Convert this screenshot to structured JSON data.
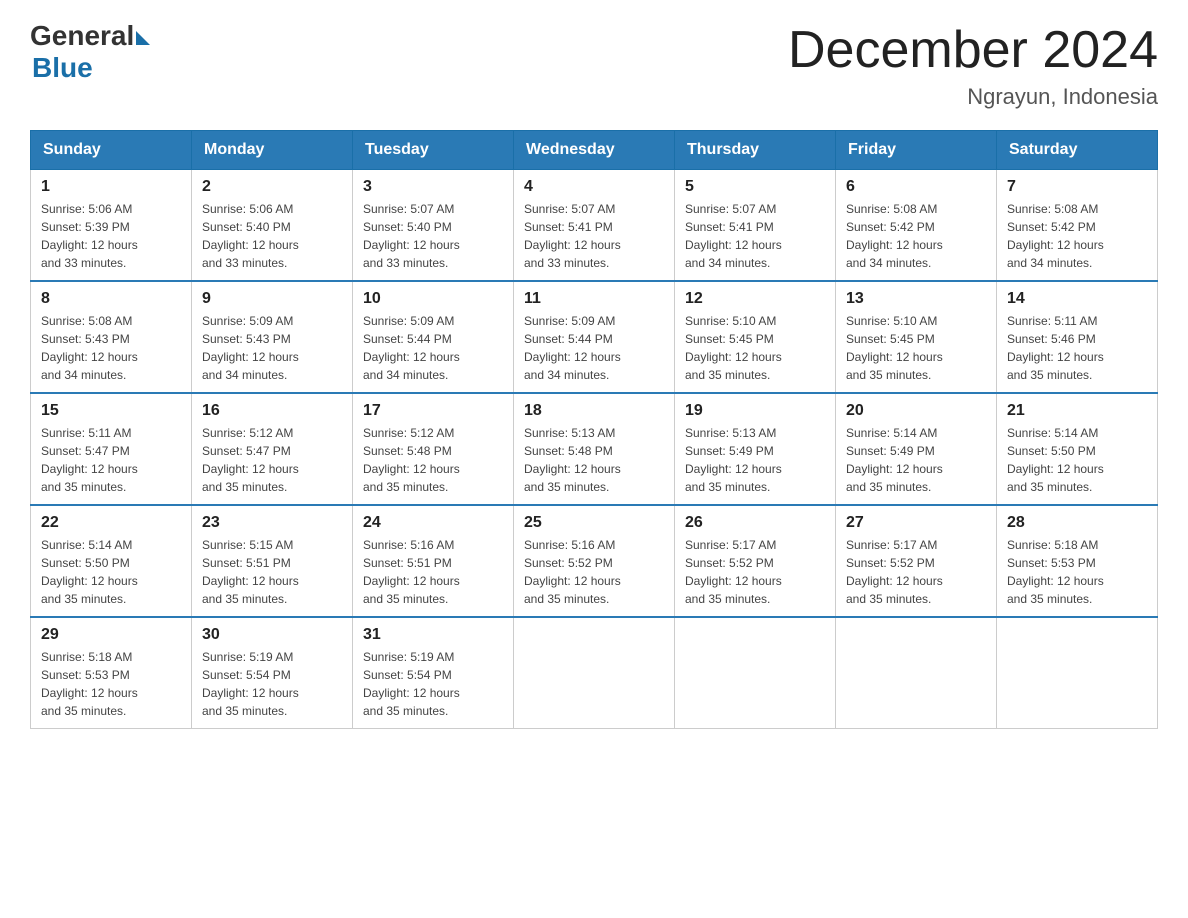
{
  "header": {
    "logo_general": "General",
    "logo_blue": "Blue",
    "month_title": "December 2024",
    "location": "Ngrayun, Indonesia"
  },
  "days_of_week": [
    "Sunday",
    "Monday",
    "Tuesday",
    "Wednesday",
    "Thursday",
    "Friday",
    "Saturday"
  ],
  "weeks": [
    [
      {
        "day": "1",
        "sunrise": "5:06 AM",
        "sunset": "5:39 PM",
        "daylight": "12 hours and 33 minutes."
      },
      {
        "day": "2",
        "sunrise": "5:06 AM",
        "sunset": "5:40 PM",
        "daylight": "12 hours and 33 minutes."
      },
      {
        "day": "3",
        "sunrise": "5:07 AM",
        "sunset": "5:40 PM",
        "daylight": "12 hours and 33 minutes."
      },
      {
        "day": "4",
        "sunrise": "5:07 AM",
        "sunset": "5:41 PM",
        "daylight": "12 hours and 33 minutes."
      },
      {
        "day": "5",
        "sunrise": "5:07 AM",
        "sunset": "5:41 PM",
        "daylight": "12 hours and 34 minutes."
      },
      {
        "day": "6",
        "sunrise": "5:08 AM",
        "sunset": "5:42 PM",
        "daylight": "12 hours and 34 minutes."
      },
      {
        "day": "7",
        "sunrise": "5:08 AM",
        "sunset": "5:42 PM",
        "daylight": "12 hours and 34 minutes."
      }
    ],
    [
      {
        "day": "8",
        "sunrise": "5:08 AM",
        "sunset": "5:43 PM",
        "daylight": "12 hours and 34 minutes."
      },
      {
        "day": "9",
        "sunrise": "5:09 AM",
        "sunset": "5:43 PM",
        "daylight": "12 hours and 34 minutes."
      },
      {
        "day": "10",
        "sunrise": "5:09 AM",
        "sunset": "5:44 PM",
        "daylight": "12 hours and 34 minutes."
      },
      {
        "day": "11",
        "sunrise": "5:09 AM",
        "sunset": "5:44 PM",
        "daylight": "12 hours and 34 minutes."
      },
      {
        "day": "12",
        "sunrise": "5:10 AM",
        "sunset": "5:45 PM",
        "daylight": "12 hours and 35 minutes."
      },
      {
        "day": "13",
        "sunrise": "5:10 AM",
        "sunset": "5:45 PM",
        "daylight": "12 hours and 35 minutes."
      },
      {
        "day": "14",
        "sunrise": "5:11 AM",
        "sunset": "5:46 PM",
        "daylight": "12 hours and 35 minutes."
      }
    ],
    [
      {
        "day": "15",
        "sunrise": "5:11 AM",
        "sunset": "5:47 PM",
        "daylight": "12 hours and 35 minutes."
      },
      {
        "day": "16",
        "sunrise": "5:12 AM",
        "sunset": "5:47 PM",
        "daylight": "12 hours and 35 minutes."
      },
      {
        "day": "17",
        "sunrise": "5:12 AM",
        "sunset": "5:48 PM",
        "daylight": "12 hours and 35 minutes."
      },
      {
        "day": "18",
        "sunrise": "5:13 AM",
        "sunset": "5:48 PM",
        "daylight": "12 hours and 35 minutes."
      },
      {
        "day": "19",
        "sunrise": "5:13 AM",
        "sunset": "5:49 PM",
        "daylight": "12 hours and 35 minutes."
      },
      {
        "day": "20",
        "sunrise": "5:14 AM",
        "sunset": "5:49 PM",
        "daylight": "12 hours and 35 minutes."
      },
      {
        "day": "21",
        "sunrise": "5:14 AM",
        "sunset": "5:50 PM",
        "daylight": "12 hours and 35 minutes."
      }
    ],
    [
      {
        "day": "22",
        "sunrise": "5:14 AM",
        "sunset": "5:50 PM",
        "daylight": "12 hours and 35 minutes."
      },
      {
        "day": "23",
        "sunrise": "5:15 AM",
        "sunset": "5:51 PM",
        "daylight": "12 hours and 35 minutes."
      },
      {
        "day": "24",
        "sunrise": "5:16 AM",
        "sunset": "5:51 PM",
        "daylight": "12 hours and 35 minutes."
      },
      {
        "day": "25",
        "sunrise": "5:16 AM",
        "sunset": "5:52 PM",
        "daylight": "12 hours and 35 minutes."
      },
      {
        "day": "26",
        "sunrise": "5:17 AM",
        "sunset": "5:52 PM",
        "daylight": "12 hours and 35 minutes."
      },
      {
        "day": "27",
        "sunrise": "5:17 AM",
        "sunset": "5:52 PM",
        "daylight": "12 hours and 35 minutes."
      },
      {
        "day": "28",
        "sunrise": "5:18 AM",
        "sunset": "5:53 PM",
        "daylight": "12 hours and 35 minutes."
      }
    ],
    [
      {
        "day": "29",
        "sunrise": "5:18 AM",
        "sunset": "5:53 PM",
        "daylight": "12 hours and 35 minutes."
      },
      {
        "day": "30",
        "sunrise": "5:19 AM",
        "sunset": "5:54 PM",
        "daylight": "12 hours and 35 minutes."
      },
      {
        "day": "31",
        "sunrise": "5:19 AM",
        "sunset": "5:54 PM",
        "daylight": "12 hours and 35 minutes."
      },
      null,
      null,
      null,
      null
    ]
  ],
  "labels": {
    "sunrise_prefix": "Sunrise: ",
    "sunset_prefix": "Sunset: ",
    "daylight_prefix": "Daylight: "
  }
}
